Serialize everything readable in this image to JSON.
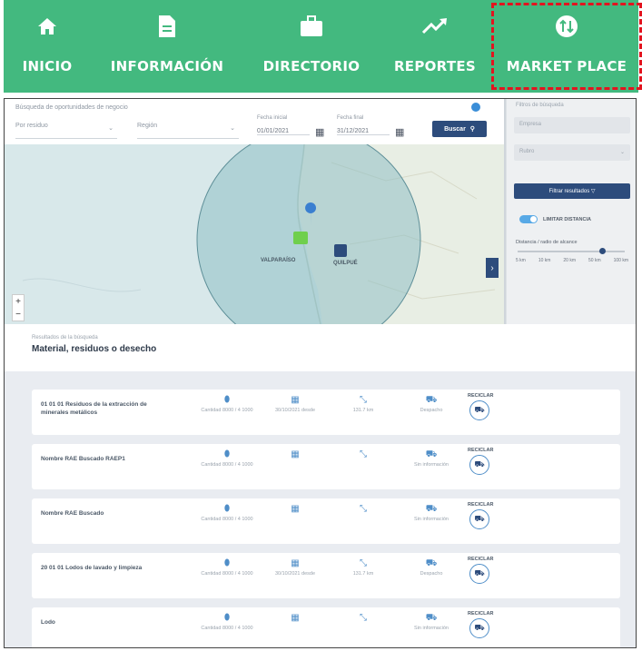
{
  "nav": {
    "items": [
      {
        "label": "INICIO",
        "icon": "home-icon"
      },
      {
        "label": "INFORMACIÓN",
        "icon": "document-icon"
      },
      {
        "label": "DIRECTORIO",
        "icon": "briefcase-icon"
      },
      {
        "label": "REPORTES",
        "icon": "trending-up-icon"
      },
      {
        "label": "MARKET PLACE",
        "icon": "swap-vertical-icon"
      }
    ],
    "bg_color": "#43b97f",
    "highlight_color": "#e3141f"
  },
  "filters": {
    "title": "Búsqueda de oportunidades de negocio",
    "select1": "Por residuo",
    "select2": "Región",
    "date_from_label": "Fecha inicial",
    "date_from": "01/01/2021",
    "date_to_label": "Fecha final",
    "date_to": "31/12/2021",
    "search_label": "Buscar"
  },
  "map": {
    "labels": [
      "VALPARAÍSO",
      "QUILPUÉ"
    ]
  },
  "panel": {
    "title": "Filtros de búsqueda",
    "input1": "Empresa",
    "input2": "Rubro",
    "more_filters": "Filtrar resultados ▽",
    "toggle_label": "LIMITAR DISTANCIA",
    "radius_label": "Distancia / radio de alcance",
    "ticks": [
      "5 km",
      "10 km",
      "20 km",
      "50 km",
      "100 km"
    ]
  },
  "results": {
    "subtitle": "Resultados de la búsqueda",
    "title": "Material, residuos o desecho",
    "rows": [
      {
        "name": "01 01 01 Residuos de la extracción de minerales metálicos",
        "loc": "Cantidad 8000 / 4 1000",
        "date": "30/10/2021 desde",
        "dist": "131.7 km",
        "ship": "Despacho",
        "act": "RECICLAR"
      },
      {
        "name": "Nombre RAE Buscado RAEP1",
        "loc": "Cantidad 8000 / 4 1000",
        "date": "",
        "dist": "",
        "ship": "Sin información",
        "act": "RECICLAR"
      },
      {
        "name": "Nombre RAE Buscado",
        "loc": "Cantidad 8000 / 4 1000",
        "date": "",
        "dist": "",
        "ship": "Sin información",
        "act": "RECICLAR"
      },
      {
        "name": "20 01 01 Lodos de lavado y limpieza",
        "loc": "Cantidad 8000 / 4 1000",
        "date": "30/10/2021 desde",
        "dist": "131.7 km",
        "ship": "Despacho",
        "act": "RECICLAR"
      },
      {
        "name": "Lodo",
        "loc": "Cantidad 8000 / 4 1000",
        "date": "",
        "dist": "",
        "ship": "Sin información",
        "act": "RECICLAR"
      }
    ]
  }
}
